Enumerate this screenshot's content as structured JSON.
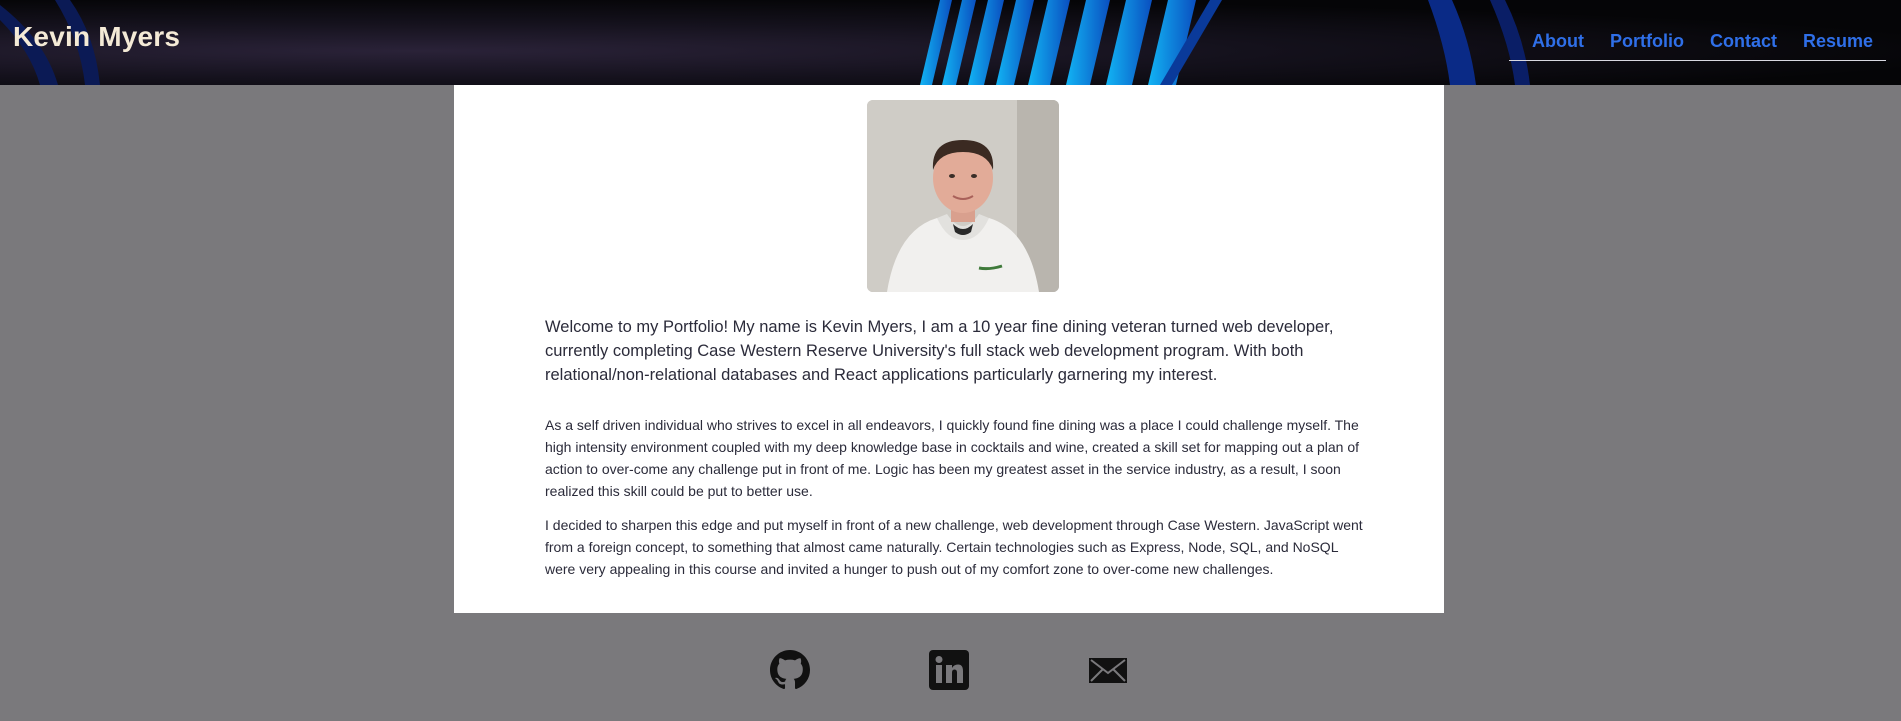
{
  "header": {
    "title": "Kevin Myers",
    "nav": [
      {
        "label": "About"
      },
      {
        "label": "Portfolio"
      },
      {
        "label": "Contact"
      },
      {
        "label": "Resume"
      }
    ]
  },
  "about": {
    "photo_alt": "Kevin Myers",
    "intro": "Welcome to my Portfolio! My name is Kevin Myers, I am a 10 year fine dining veteran turned web developer, currently completing Case Western Reserve University's full stack web development program. With both relational/non-relational databases and React applications particularly garnering my interest.",
    "paragraphs": [
      "As a self driven individual who strives to excel in all endeavors, I quickly found fine dining was a place I could challenge myself. The high intensity environment coupled with my deep knowledge base in cocktails and wine, created a skill set for mapping out a plan of action to over-come any challenge put in front of me. Logic has been my greatest asset in the service industry, as a result, I soon realized this skill could be put to better use.",
      "I decided to sharpen this edge and put myself in front of a new challenge, web development through Case Western. JavaScript went from a foreign concept, to something that almost came naturally. Certain technologies such as Express, Node, SQL, and NoSQL were very appealing in this course and invited a hunger to push out of my comfort zone to over-come new challenges."
    ]
  },
  "footer": {
    "socials": [
      {
        "icon": "github-icon"
      },
      {
        "icon": "linkedin-icon"
      },
      {
        "icon": "mail-icon"
      }
    ]
  },
  "colors": {
    "header_bg": "#050507",
    "title": "#f4ead6",
    "nav_link": "#2f6fe8",
    "page_bg": "#7a797c",
    "card_bg": "#ffffff",
    "accent_stripe": "#00a8f0"
  }
}
